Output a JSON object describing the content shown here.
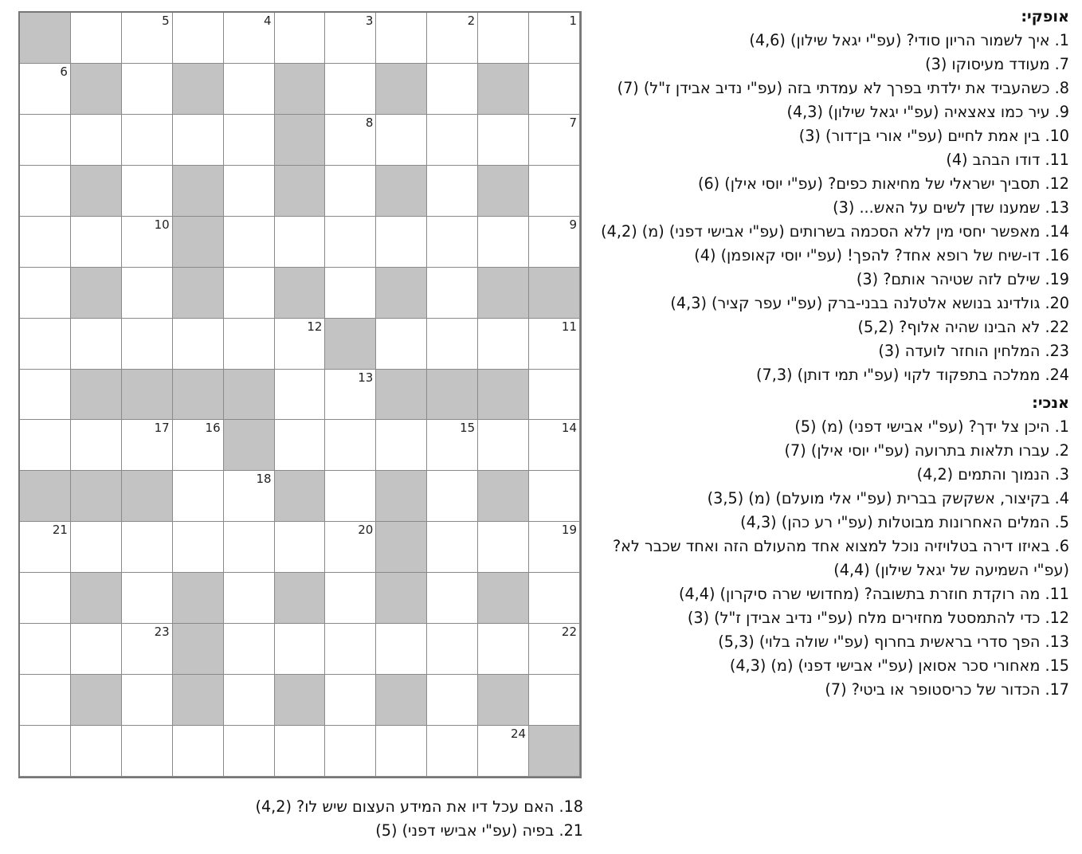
{
  "grid": {
    "rows": 15,
    "cols": 11,
    "cells": [
      [
        "W",
        "W",
        "W",
        "W",
        "W",
        "W",
        "W",
        "W",
        "W",
        "W",
        "B"
      ],
      [
        "W",
        "B",
        "W",
        "B",
        "W",
        "B",
        "W",
        "B",
        "W",
        "B",
        "W"
      ],
      [
        "W",
        "W",
        "W",
        "W",
        "W",
        "B",
        "W",
        "W",
        "W",
        "W",
        "W"
      ],
      [
        "W",
        "B",
        "W",
        "B",
        "W",
        "B",
        "W",
        "B",
        "W",
        "B",
        "W"
      ],
      [
        "W",
        "W",
        "W",
        "W",
        "W",
        "W",
        "W",
        "B",
        "W",
        "W",
        "W"
      ],
      [
        "B",
        "B",
        "W",
        "B",
        "W",
        "B",
        "W",
        "B",
        "W",
        "B",
        "W"
      ],
      [
        "W",
        "W",
        "W",
        "W",
        "B",
        "W",
        "W",
        "W",
        "W",
        "W",
        "W"
      ],
      [
        "W",
        "B",
        "B",
        "B",
        "W",
        "W",
        "B",
        "B",
        "B",
        "B",
        "W"
      ],
      [
        "W",
        "W",
        "W",
        "W",
        "W",
        "W",
        "B",
        "W",
        "W",
        "W",
        "W"
      ],
      [
        "W",
        "B",
        "W",
        "B",
        "W",
        "B",
        "W",
        "W",
        "B",
        "B",
        "B"
      ],
      [
        "W",
        "W",
        "W",
        "B",
        "W",
        "W",
        "W",
        "W",
        "W",
        "W",
        "W"
      ],
      [
        "W",
        "B",
        "W",
        "B",
        "W",
        "B",
        "W",
        "B",
        "W",
        "B",
        "W"
      ],
      [
        "W",
        "W",
        "W",
        "W",
        "W",
        "W",
        "W",
        "B",
        "W",
        "W",
        "W"
      ],
      [
        "W",
        "B",
        "W",
        "B",
        "W",
        "B",
        "W",
        "B",
        "W",
        "B",
        "W"
      ],
      [
        "B",
        "W",
        "W",
        "W",
        "W",
        "W",
        "W",
        "W",
        "W",
        "W",
        "W"
      ]
    ],
    "numbers": [
      {
        "r": 0,
        "c": 0,
        "n": "1"
      },
      {
        "r": 0,
        "c": 2,
        "n": "2"
      },
      {
        "r": 0,
        "c": 4,
        "n": "3"
      },
      {
        "r": 0,
        "c": 6,
        "n": "4"
      },
      {
        "r": 0,
        "c": 8,
        "n": "5"
      },
      {
        "r": 1,
        "c": 10,
        "n": "6"
      },
      {
        "r": 2,
        "c": 0,
        "n": "7"
      },
      {
        "r": 2,
        "c": 4,
        "n": "8"
      },
      {
        "r": 4,
        "c": 0,
        "n": "9"
      },
      {
        "r": 4,
        "c": 8,
        "n": "10"
      },
      {
        "r": 6,
        "c": 0,
        "n": "11"
      },
      {
        "r": 6,
        "c": 5,
        "n": "12"
      },
      {
        "r": 7,
        "c": 4,
        "n": "13"
      },
      {
        "r": 8,
        "c": 0,
        "n": "14"
      },
      {
        "r": 8,
        "c": 2,
        "n": "15"
      },
      {
        "r": 8,
        "c": 7,
        "n": "16"
      },
      {
        "r": 8,
        "c": 8,
        "n": "17"
      },
      {
        "r": 9,
        "c": 6,
        "n": "18"
      },
      {
        "r": 10,
        "c": 0,
        "n": "19"
      },
      {
        "r": 10,
        "c": 4,
        "n": "20"
      },
      {
        "r": 10,
        "c": 10,
        "n": "21"
      },
      {
        "r": 12,
        "c": 0,
        "n": "22"
      },
      {
        "r": 12,
        "c": 8,
        "n": "23"
      },
      {
        "r": 14,
        "c": 1,
        "n": "24"
      }
    ]
  },
  "across": {
    "title": "אופקי:",
    "clues": [
      "1. איך לשמור הריון סודי? (עפ\"י יגאל שילון) (4,6)",
      "7. מעודד מעיסוקו (3)",
      "8. כשהעביד את ילדתי בפרך לא עמדתי בזה (עפ\"י נדיב אבידן ז\"ל) (7)",
      "9. עיר כמו צאצאיה (עפ\"י יגאל שילון) (4,3)",
      "10. בין אמת לחיים (עפ\"י אורי בן־דור) (3)",
      "11. דודו הבהב (4)",
      "12. תסביך ישראלי של מחיאות כפים? (עפ\"י יוסי אילן) (6)",
      "13. שמענו שדן לשים על האש... (3)",
      "14. מאפשר יחסי מין ללא הסכמה בשרותים (עפ\"י אבישי דפני) (מ) (4,2)",
      "16. דו-שיח של רופא אחד? להפך! (עפ\"י יוסי קאופמן) (4)",
      "19. שילם לזה שטיהר אותם? (3)",
      "20. גולדינג בנושא אלטלנה בבני-ברק (עפ\"י עפר קציר) (4,3)",
      "22. לא הבינו שהיה אלוף? (5,2)",
      "23. המלחין הוחזר לועדה (3)",
      "24. ממלכה בתפקוד לקוי (עפ\"י תמי דותן) (7,3)"
    ]
  },
  "down": {
    "title": "אנכי:",
    "clues": [
      "1. היכן צל ידך? (עפ\"י אבישי דפני) (מ) (5)",
      "2. עברו תלאות בתרועה (עפ\"י יוסי אילן) (7)",
      "3. הנמוך והתמים (4,2)",
      "4. בקיצור, אשקשק בברית (עפ\"י אלי מועלם) (מ) (3,5)",
      "5. המלים האחרונות מבוטלות (עפ\"י רע כהן) (4,3)",
      "6. באיזו דירה בטלויזיה נוכל למצוא אחד מהעולם הזה ואחד שכבר לא? (עפ\"י השמיעה של יגאל שילון) (4,4)",
      "11. מה רוקדת חוזרת בתשובה? (מחדושי שרה סיקרון) (4,4)",
      "12. כדי להתמסטל מחזירים מלח (עפ\"י נדיב אבידן ז\"ל) (3)",
      "13. הפך סדרי בראשית בחרוף (עפ\"י שולה בלוי) (5,3)",
      "15. מאחורי סכר אסואן (עפ\"י אבישי דפני) (מ) (4,3)",
      "17. הכדור של כריסטופר או ביטי? (7)"
    ]
  },
  "down_extra": [
    "18. האם עכל דיו את המידע העצום שיש לו? (4,2)",
    "21. בפיה (עפ\"י אבישי דפני) (5)"
  ]
}
